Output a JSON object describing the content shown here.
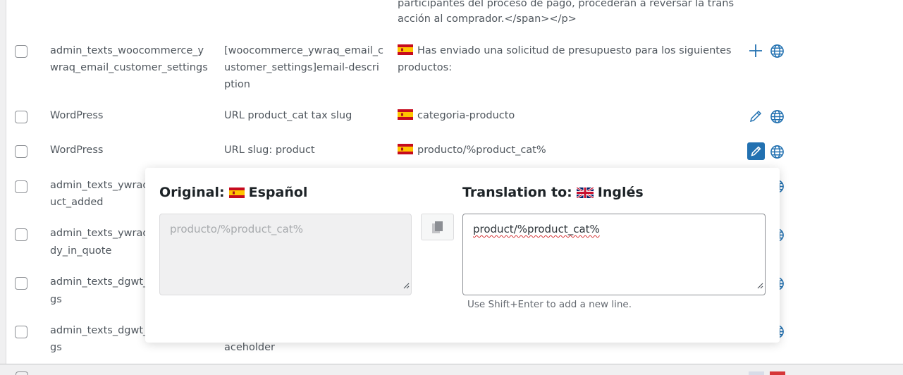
{
  "rows": [
    {
      "context": "",
      "name": "",
      "string_lines": [
        "participantes del proceso de pago, procederán a reversar la trans",
        "acción al comprador.</span></p>"
      ]
    },
    {
      "context_lines": [
        "admin_texts_woocommerce_y",
        "wraq_email_customer_settings"
      ],
      "name_lines": [
        "[woocommerce_ywraq_email_c",
        "ustomer_settings]email-descri",
        "ption"
      ],
      "string_lines": [
        "Has enviado una solicitud de presupuesto para los siguientes",
        "productos:"
      ]
    },
    {
      "context": "WordPress",
      "name": "URL product_cat tax slug",
      "string": "categoria-producto"
    },
    {
      "context": "WordPress",
      "name": "URL slug: product",
      "string": "producto/%product_cat%"
    },
    {
      "context_lines": [
        "admin_texts_ywraq",
        "uct_added"
      ]
    },
    {
      "context_lines": [
        "admin_texts_ywraq",
        "dy_in_quote"
      ]
    },
    {
      "context_lines": [
        "admin_texts_dgwt_",
        "gs"
      ]
    },
    {
      "context_lines": [
        "admin_texts_dgwt_",
        "gs"
      ],
      "name_partial": "aceholder"
    }
  ],
  "popup": {
    "original_label": "Original:",
    "original_language": "Español",
    "original_text": "producto/%product_cat%",
    "translation_label": "Translation to:",
    "translation_language": "Inglés",
    "translation_text": "product/%product_cat%",
    "hint": "Use Shift+Enter to add a new line."
  },
  "colors": {
    "accent": "#2271b1",
    "icon_blue": "#2271b1",
    "text": "#50575e",
    "heading": "#1d2327"
  },
  "icons": [
    "checkbox",
    "plus-icon",
    "globe-icon",
    "pencil-icon",
    "copy-icon",
    "flag-es-icon",
    "flag-uk-icon",
    "resize-grip-icon"
  ]
}
